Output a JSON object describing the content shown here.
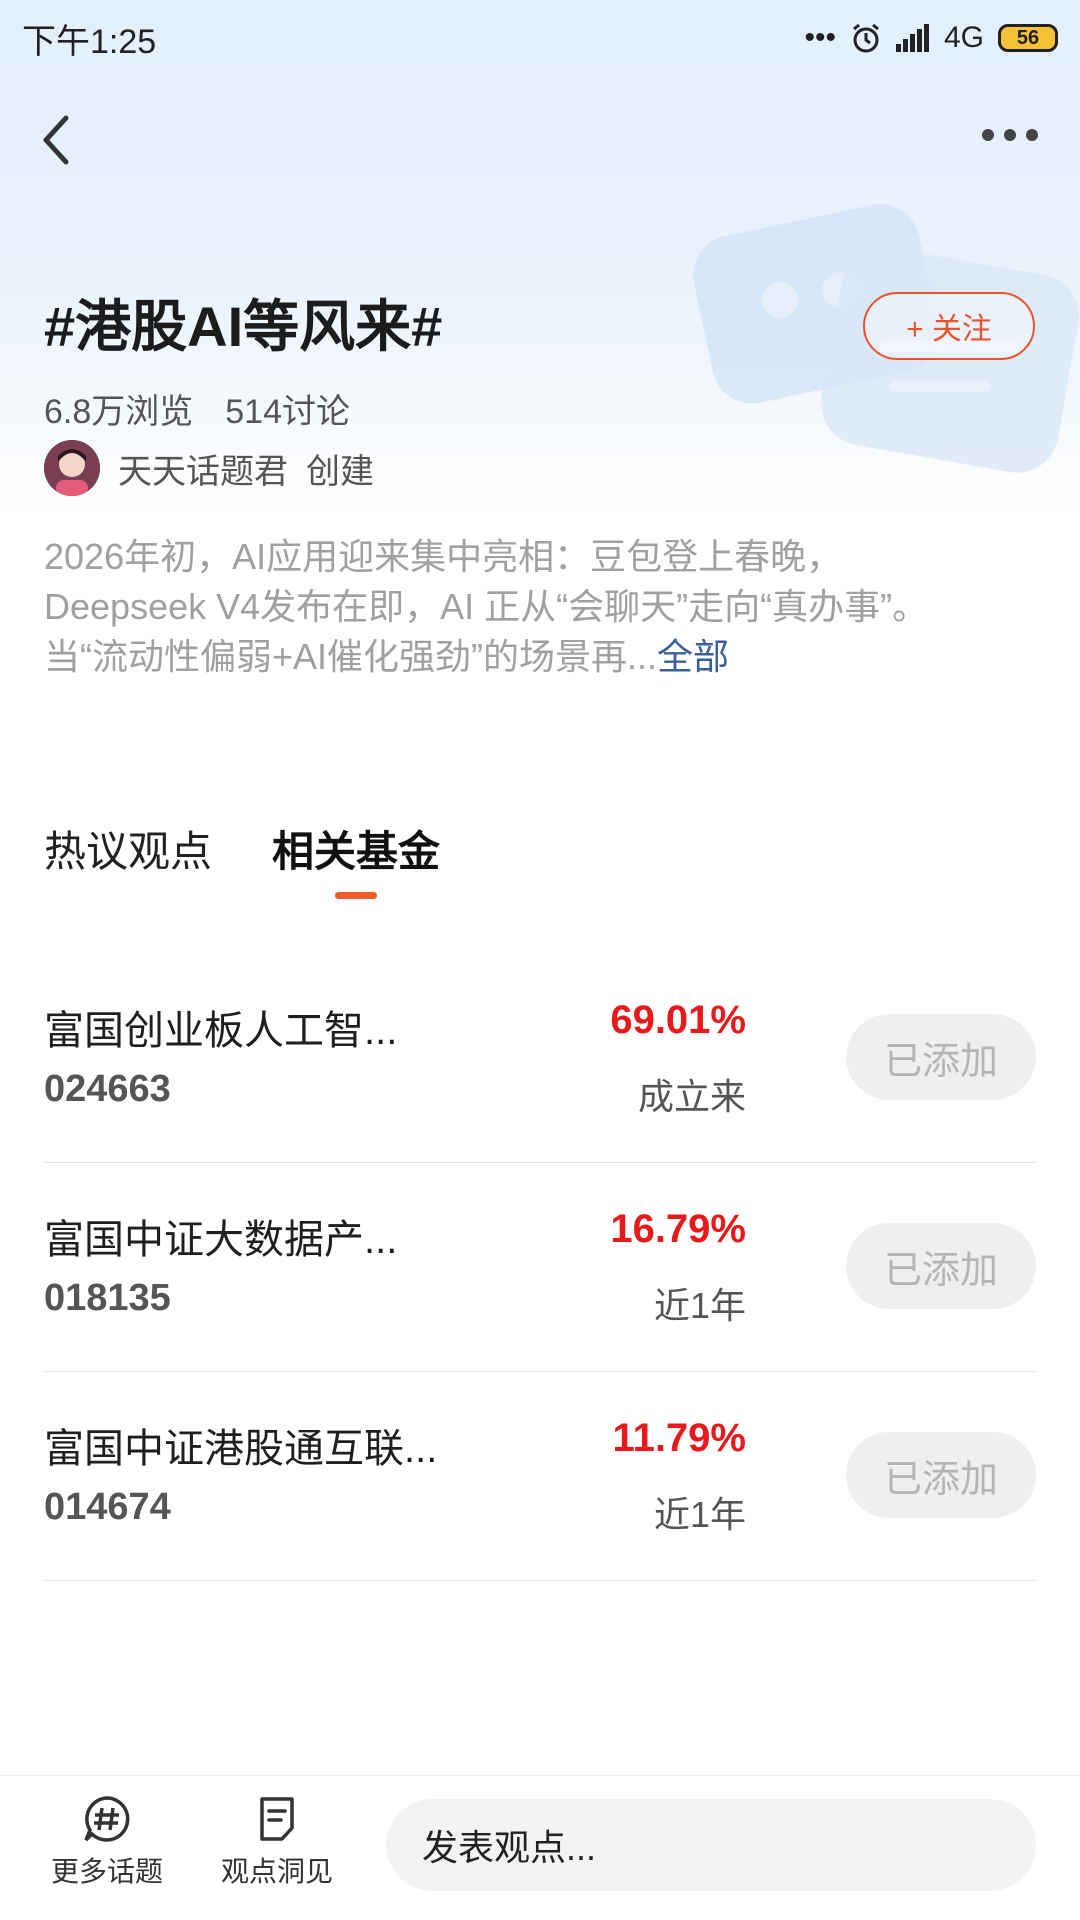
{
  "status_bar": {
    "time": "下午1:25",
    "network": "4G",
    "battery": "56"
  },
  "topic": {
    "title": "#港股AI等风来#",
    "follow_label": "+ 关注",
    "views": "6.8万浏览",
    "discussions": "514讨论",
    "creator_name": "天天话题君",
    "creator_action": "创建",
    "description": "2026年初，AI应用迎来集中亮相：豆包登上春晚，Deepseek V4发布在即，AI 正从“会聊天”走向“真办事”。当“流动性偏弱+AI催化强劲”的场景再...",
    "more_label": "全部"
  },
  "tabs": [
    {
      "label": "热议观点",
      "active": false
    },
    {
      "label": "相关基金",
      "active": true
    }
  ],
  "funds": [
    {
      "name": "富国创业板人工智...",
      "code": "024663",
      "rate": "69.01%",
      "period": "成立来",
      "action": "已添加"
    },
    {
      "name": "富国中证大数据产...",
      "code": "018135",
      "rate": "16.79%",
      "period": "近1年",
      "action": "已添加"
    },
    {
      "name": "富国中证港股通互联...",
      "code": "014674",
      "rate": "11.79%",
      "period": "近1年",
      "action": "已添加"
    }
  ],
  "bottom_bar": {
    "more_topics_label": "更多话题",
    "insights_label": "观点洞见",
    "comment_placeholder": "发表观点..."
  },
  "colors": {
    "accent": "#e8542e",
    "rate_red": "#e8191b",
    "link_blue": "#3a5d9c",
    "tab_underline": "#f05a2a"
  },
  "icons": {
    "back": "chevron-left-icon",
    "more": "more-dots-icon",
    "topic": "hashtag-bubble-icon",
    "insight": "document-icon"
  }
}
